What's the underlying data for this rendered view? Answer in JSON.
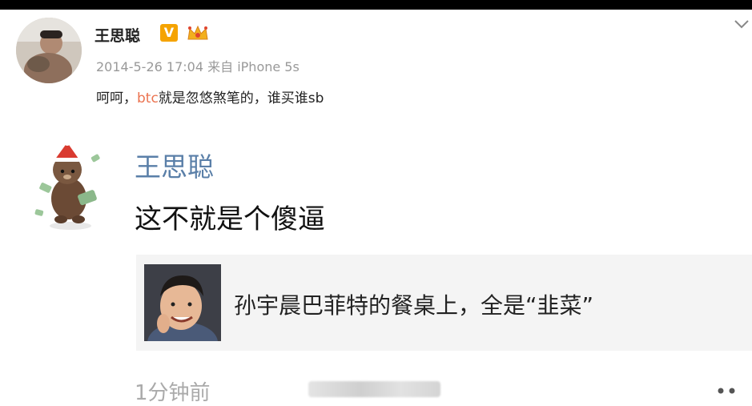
{
  "post": {
    "author": "王思聪",
    "vip_badge": "V",
    "timestamp": "2014-5-26 17:04",
    "source_prefix": "来自",
    "source_device": "iPhone 5s",
    "content_prefix": "呵呵，",
    "content_highlight": "btc",
    "content_suffix": "就是忽悠煞笔的，谁买谁sb",
    "highlight_color": "#eb7350"
  },
  "comment": {
    "author": "王思聪",
    "text": "这不就是个傻逼",
    "quote_title": "孙宇晨巴菲特的餐桌上，全是“韭菜”",
    "time": "1分钟前",
    "author_color": "#5a7fa8"
  },
  "icons": {
    "menu": "chevron-down-icon",
    "more": "more-icon",
    "badge_vip": "verified-v-icon",
    "badge_crown": "crown-icon"
  }
}
